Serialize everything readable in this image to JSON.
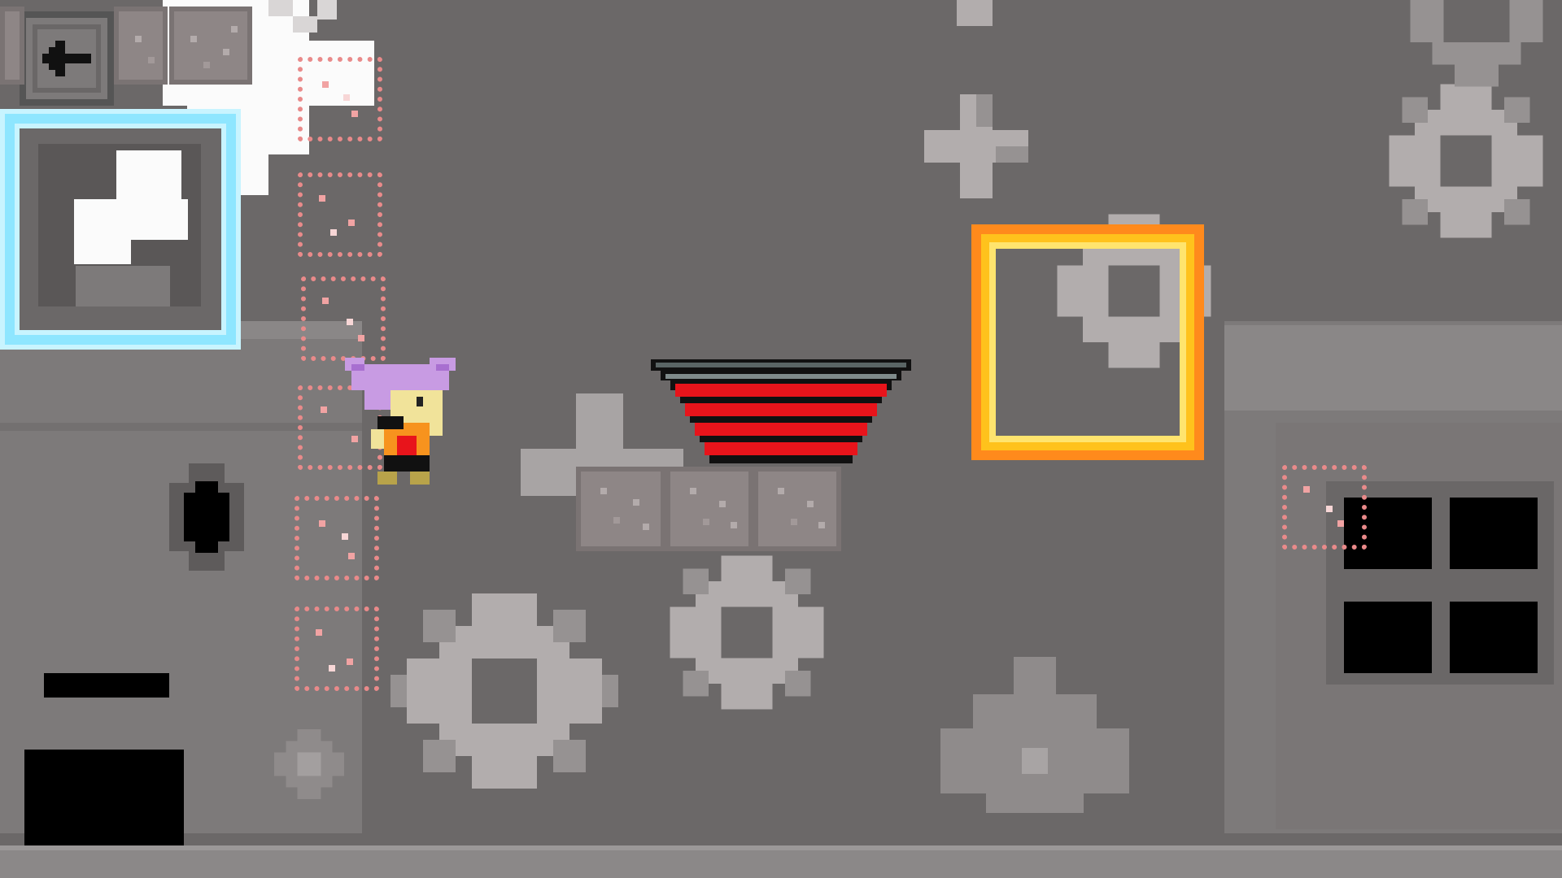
{
  "game": {
    "colors": {
      "background": "#6b6868",
      "structure": "#7d7a7a",
      "structure_light": "#8a8787",
      "gear_light": "#b2adad",
      "gear_dark": "#969292",
      "crystal_frame": "#7fe0ff",
      "fire_frame": "#ff8a1c",
      "spring_red": "#e8141b",
      "ghost_dots": "#e98a8a",
      "player_hair": "#c89be3"
    },
    "hud": {
      "back_button_icon": "arrow-left-icon"
    },
    "player": {
      "character": "purple-haired-girl",
      "pose": "climbing"
    },
    "items": {
      "crystal_frame_icon": "ice-block-icon",
      "fire_frame_icon": "fire-block-icon",
      "spring_icon": "bounce-pad-icon"
    }
  }
}
